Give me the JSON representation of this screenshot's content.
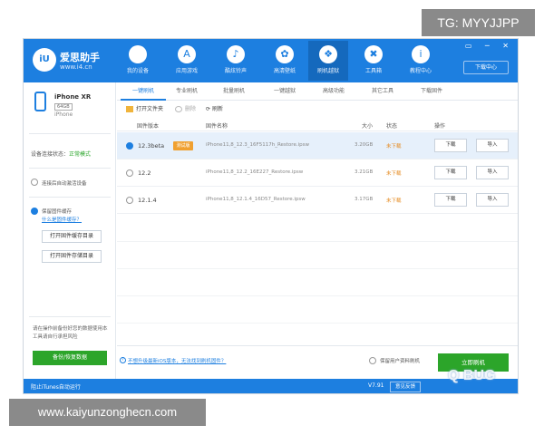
{
  "overlays": {
    "tg": "TG: MYYJJPP",
    "url": "www.kaiyunzonghecn.com"
  },
  "app": {
    "logo_text": "iU",
    "brand": "爱思助手",
    "site": "www.i4.cn"
  },
  "nav": [
    {
      "label": "我的设备",
      "icon": "apple-icon",
      "glyph": ""
    },
    {
      "label": "应用游戏",
      "icon": "appstore-icon",
      "glyph": "A"
    },
    {
      "label": "酷炫铃声",
      "icon": "bell-icon",
      "glyph": "♪"
    },
    {
      "label": "高清壁纸",
      "icon": "wallpaper-icon",
      "glyph": "✿"
    },
    {
      "label": "刷机越狱",
      "icon": "box-icon",
      "glyph": "❖"
    },
    {
      "label": "工具箱",
      "icon": "tools-icon",
      "glyph": "✖"
    },
    {
      "label": "教程中心",
      "icon": "info-icon",
      "glyph": "i"
    }
  ],
  "window_controls": "▭ ─ ✕",
  "download_center": "下载中心",
  "device": {
    "name": "iPhone XR",
    "capacity": "64GB",
    "model": "iPhone"
  },
  "sidebar": {
    "connection_label": "设备连接状态：",
    "connection_value": "正常模式",
    "option1": "连接后自动激活设备",
    "option2": "保留固件缓存",
    "option2_link": "什么是固件缓存？",
    "btn_open_cache": "打开固件缓存目录",
    "btn_open_storage": "打开固件存储目录",
    "tip": "请在操作前备份好您的数据使用本工具请自行承担风险",
    "backup_button": "备份/恢复数据"
  },
  "tabs": [
    "一键刷机",
    "专业刷机",
    "批量刷机",
    "一键越狱",
    "高级功能",
    "其它工具",
    "下载固件"
  ],
  "toolbar": {
    "open_folder": "打开文件夹",
    "delete": "删除",
    "refresh": "刷新"
  },
  "table": {
    "headers": {
      "version": "固件版本",
      "name": "固件名称",
      "size": "大小",
      "status": "状态",
      "action": "操作"
    },
    "rows": [
      {
        "version": "12.3beta",
        "badge": "测试版",
        "name": "iPhone11,8_12.3_16F5117h_Restore.ipsw",
        "size": "3.20GB",
        "status": "未下载",
        "download": "下载",
        "import": "导入"
      },
      {
        "version": "12.2",
        "badge": "",
        "name": "iPhone11,8_12.2_16E227_Restore.ipsw",
        "size": "3.21GB",
        "status": "未下载",
        "download": "下载",
        "import": "导入"
      },
      {
        "version": "12.1.4",
        "badge": "",
        "name": "iPhone11,8_12.1.4_16D57_Restore.ipsw",
        "size": "3.17GB",
        "status": "未下载",
        "download": "下载",
        "import": "导入"
      }
    ]
  },
  "bottom": {
    "help_link": "不想升级最新iOS版本，无法找到刷机固件？",
    "keep_data": "保留用户资料刷机",
    "flash_button": "立即刷机"
  },
  "statusbar": {
    "left": "阻止iTunes自动运行",
    "version": "V7.91",
    "feedback": "意见反馈"
  },
  "watermark": "Q BUG"
}
